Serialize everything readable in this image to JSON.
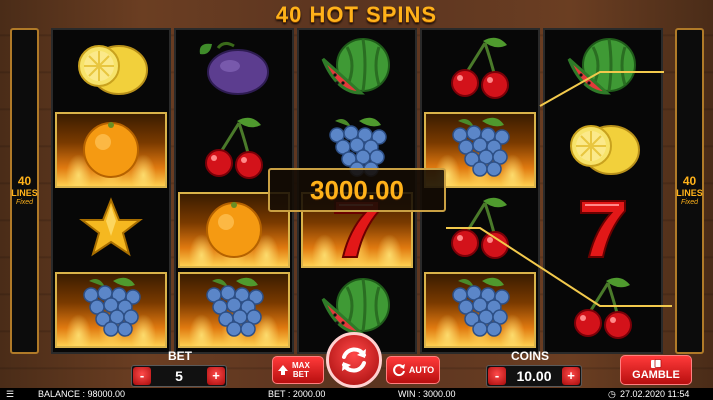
{
  "title": "40 HOT SPINS",
  "side_panels": {
    "lines_number": "40",
    "lines_word": "LINES",
    "lines_fixed": "Fixed"
  },
  "reels": [
    [
      "lemon",
      "orange",
      "star",
      "grapes"
    ],
    [
      "plum",
      "cherries",
      "orange",
      "grapes"
    ],
    [
      "watermelon",
      "grapes",
      "seven",
      "watermelon"
    ],
    [
      "cherries",
      "grapes",
      "cherries",
      "grapes"
    ],
    [
      "watermelon",
      "lemon",
      "seven",
      "cherries"
    ]
  ],
  "winning_cells": [
    [
      false,
      true,
      false,
      true
    ],
    [
      false,
      false,
      true,
      true
    ],
    [
      false,
      false,
      true,
      false
    ],
    [
      false,
      true,
      false,
      true
    ],
    [
      false,
      false,
      false,
      false
    ]
  ],
  "win_amount": "3000.00",
  "bet": {
    "label": "BET",
    "value": "5",
    "minus": "-",
    "plus": "+"
  },
  "max_bet": {
    "line1": "MAX",
    "line2": "BET"
  },
  "auto": {
    "label": "AUTO"
  },
  "coins": {
    "label": "COINS",
    "value": "10.00",
    "minus": "-",
    "plus": "+"
  },
  "gamble": {
    "label": "GAMBLE"
  },
  "status": {
    "balance": "BALANCE : 98000.00",
    "bet": "BET : 2000.00",
    "win": "WIN : 3000.00",
    "datetime": "27.02.2020 11:54"
  },
  "colors": {
    "accent": "#ffb21a",
    "button_red": "#d81e1e",
    "payline": "#f2c94c",
    "frame_gold": "#c9a043"
  }
}
